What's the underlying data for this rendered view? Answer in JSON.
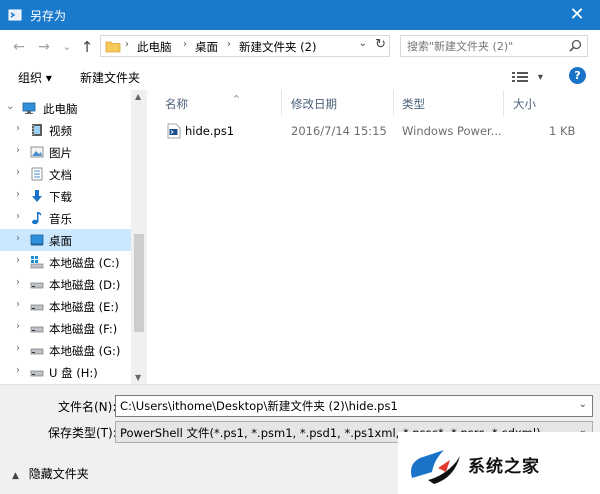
{
  "window": {
    "title": "另存为",
    "close_glyph": "✕",
    "accent_color": "#1979ca"
  },
  "address": {
    "breadcrumbs": [
      "此电脑",
      "桌面",
      "新建文件夹 (2)"
    ],
    "separator": "›",
    "dropdown_glyph": "⌄",
    "refresh_glyph": "↻"
  },
  "nav_buttons": {
    "back": "←",
    "forward": "→",
    "recent": "⌄",
    "up": "↑"
  },
  "search": {
    "placeholder": "搜索\"新建文件夹 (2)\""
  },
  "toolbar": {
    "organize_label": "组织 ▾",
    "new_folder_label": "新建文件夹",
    "view_glyph": "▾",
    "help_label": "?"
  },
  "nav_pane": {
    "items": [
      {
        "label": "此电脑",
        "icon": "computer-icon",
        "expanded": true
      },
      {
        "label": "视频",
        "icon": "video-folder-icon"
      },
      {
        "label": "图片",
        "icon": "pictures-folder-icon"
      },
      {
        "label": "文档",
        "icon": "documents-folder-icon"
      },
      {
        "label": "下载",
        "icon": "download-folder-icon"
      },
      {
        "label": "音乐",
        "icon": "music-folder-icon"
      },
      {
        "label": "桌面",
        "icon": "desktop-folder-icon",
        "selected": true
      },
      {
        "label": "本地磁盘 (C:)",
        "icon": "windows-drive-icon"
      },
      {
        "label": "本地磁盘 (D:)",
        "icon": "drive-icon"
      },
      {
        "label": "本地磁盘 (E:)",
        "icon": "drive-icon"
      },
      {
        "label": "本地磁盘 (F:)",
        "icon": "drive-icon"
      },
      {
        "label": "本地磁盘 (G:)",
        "icon": "drive-icon"
      },
      {
        "label": "U 盘 (H:)",
        "icon": "usb-drive-icon"
      }
    ],
    "chevron_right": "›",
    "chevron_down": "⌄"
  },
  "file_list": {
    "columns": [
      "名称",
      "修改日期",
      "类型",
      "大小"
    ],
    "sort_arrow": "^",
    "files": [
      {
        "name": "hide.ps1",
        "modified": "2016/7/14 15:15",
        "type": "Windows Power...",
        "size": "1 KB",
        "icon": "powershell-script-icon"
      }
    ]
  },
  "save_fields": {
    "filename_label": "文件名(N):",
    "filename_value": "C:\\Users\\ithome\\Desktop\\新建文件夹 (2)\\hide.ps1",
    "filetype_label": "保存类型(T):",
    "filetype_value": "PowerShell 文件(*.ps1, *.psm1, *.psd1, *.ps1xml, *.pssc*, *.psrc, *.cdxml)",
    "dropdown_glyph": "⌄"
  },
  "hide_folders": {
    "glyph": "▲",
    "label": "隐藏文件夹"
  },
  "watermark": {
    "text": "系统之家"
  }
}
